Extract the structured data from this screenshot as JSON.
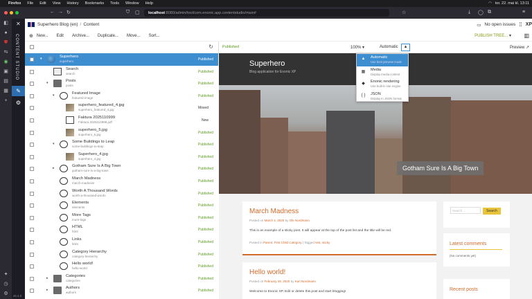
{
  "os_menu": {
    "app": "Firefox",
    "items": [
      "File",
      "Edit",
      "View",
      "History",
      "Bookmarks",
      "Tools",
      "Window",
      "Help"
    ],
    "clock": "tor. 22. mai kl. 13:11"
  },
  "browser": {
    "url_host": "localhost",
    "url_rest": ":8080/admin/tool/com.enonic.app.contentstudio/main#"
  },
  "app_rail": {
    "title": "CONTENT STUDIO",
    "version": "v5.4.0"
  },
  "header": {
    "project": "Superhero Blog (en)",
    "separator": "/",
    "section": "Content",
    "issues": "No open issues",
    "logo": "XP"
  },
  "toolbar": {
    "new": "New...",
    "edit": "Edit",
    "archive": "Archive...",
    "duplicate": "Duplicate...",
    "move": "Move...",
    "sort": "Sort...",
    "publish_tree": "PUBLISH TREE..."
  },
  "tree": {
    "rows": [
      {
        "name": "Superhero",
        "path": "superhero",
        "status": "Published",
        "icon": "globe",
        "indent": 0,
        "arrow": "▾",
        "selected": true
      },
      {
        "name": "Search",
        "path": "search",
        "status": "Published",
        "icon": "search",
        "indent": 1,
        "arrow": ""
      },
      {
        "name": "Posts",
        "path": "posts",
        "status": "Published",
        "icon": "folder",
        "indent": 1,
        "arrow": "▾"
      },
      {
        "name": "Featured Image",
        "path": "featured-image",
        "status": "Published",
        "icon": "bubble",
        "indent": 2,
        "arrow": "▾"
      },
      {
        "name": "superhero_featured_4.jpg",
        "path": "superhero_featured_4.jpg",
        "status": "Moved",
        "icon": "img",
        "indent": 3,
        "arrow": ""
      },
      {
        "name": "Faktura 2025110999",
        "path": "Faktura 2025110999.pdf",
        "status": "New",
        "icon": "doc",
        "indent": 3,
        "arrow": ""
      },
      {
        "name": "superhero_5.jpg",
        "path": "superhero_5.jpg",
        "status": "Published",
        "icon": "img",
        "indent": 3,
        "arrow": ""
      },
      {
        "name": "Some Buildings to Leap",
        "path": "some-buildings-to-leap",
        "status": "Published",
        "icon": "bubble",
        "indent": 2,
        "arrow": "▾"
      },
      {
        "name": "Superhero_4.jpg",
        "path": "superhero_4.jpg",
        "status": "Published",
        "icon": "img",
        "indent": 3,
        "arrow": ""
      },
      {
        "name": "Gotham Sure Is A Big Town",
        "path": "gotham-sure-is-a-big-town",
        "status": "Published",
        "icon": "bubble",
        "indent": 2,
        "arrow": "▸"
      },
      {
        "name": "March Madness",
        "path": "march-madness",
        "status": "Published",
        "icon": "bubble",
        "indent": 2,
        "arrow": ""
      },
      {
        "name": "Worth A Thousand Words",
        "path": "worth-a-thousand-words",
        "status": "Published",
        "icon": "bubble",
        "indent": 2,
        "arrow": ""
      },
      {
        "name": "Elements",
        "path": "elements",
        "status": "Published",
        "icon": "bubble",
        "indent": 2,
        "arrow": ""
      },
      {
        "name": "More Tags",
        "path": "more-tags",
        "status": "Published",
        "icon": "bubble",
        "indent": 2,
        "arrow": ""
      },
      {
        "name": "HTML",
        "path": "html",
        "status": "Published",
        "icon": "bubble",
        "indent": 2,
        "arrow": ""
      },
      {
        "name": "Links",
        "path": "links",
        "status": "Published",
        "icon": "bubble",
        "indent": 2,
        "arrow": ""
      },
      {
        "name": "Category Hierarchy",
        "path": "category-hierarchy",
        "status": "Published",
        "icon": "bubble",
        "indent": 2,
        "arrow": ""
      },
      {
        "name": "Hello world!",
        "path": "hello-world",
        "status": "Published",
        "icon": "bubble",
        "indent": 2,
        "arrow": ""
      },
      {
        "name": "Categories",
        "path": "categories",
        "status": "Published",
        "icon": "folder",
        "indent": 1,
        "arrow": "▸"
      },
      {
        "name": "Authors",
        "path": "authors",
        "status": "Published",
        "icon": "folder",
        "indent": 1,
        "arrow": "▸"
      }
    ]
  },
  "preview_toolbar": {
    "status": "Published",
    "zoom": "100%",
    "mode": "Automatic",
    "preview": "Preview"
  },
  "mode_menu": [
    {
      "label": "Automatic",
      "desc": "Use best preview mode",
      "icon": "automatic-icon",
      "selected": true
    },
    {
      "label": "Media",
      "desc": "Display media content",
      "icon": "media-icon"
    },
    {
      "label": "Enonic rendering",
      "desc": "Use built-in site engine",
      "icon": "enonic-icon"
    },
    {
      "label": "JSON",
      "desc": "Display in JSON format",
      "icon": "json-icon"
    }
  ],
  "site": {
    "title": "Superhero",
    "tagline": "Blog application for Enonic XP",
    "hero_caption": "Gotham Sure Is A Big Town",
    "post1": {
      "title": "March Madness",
      "meta_prefix": "Posted on",
      "date": "March 4, 2020",
      "by": "by",
      "author": "Ole Nordmann",
      "excerpt": "This is an example of a sticky post. It will appear at the top of the post list and the title will be red.",
      "posted_in": "Posted in",
      "cats": "Parent, First Child Category",
      "tagged": "| Tagged",
      "tags": "test, sticky"
    },
    "post2": {
      "title": "Hello world!",
      "meta_prefix": "Posted on",
      "date": "February 28, 2020",
      "by": "by",
      "author": "Kari Nordmann",
      "excerpt": "Welcome to Enonic XP. Edit or delete this post and start blogging!"
    },
    "search_placeholder": "Search ...",
    "search_button": "Search",
    "latest_comments": "Latest comments",
    "no_comments": "(No comments yet)",
    "recent_posts": "Recent posts"
  }
}
